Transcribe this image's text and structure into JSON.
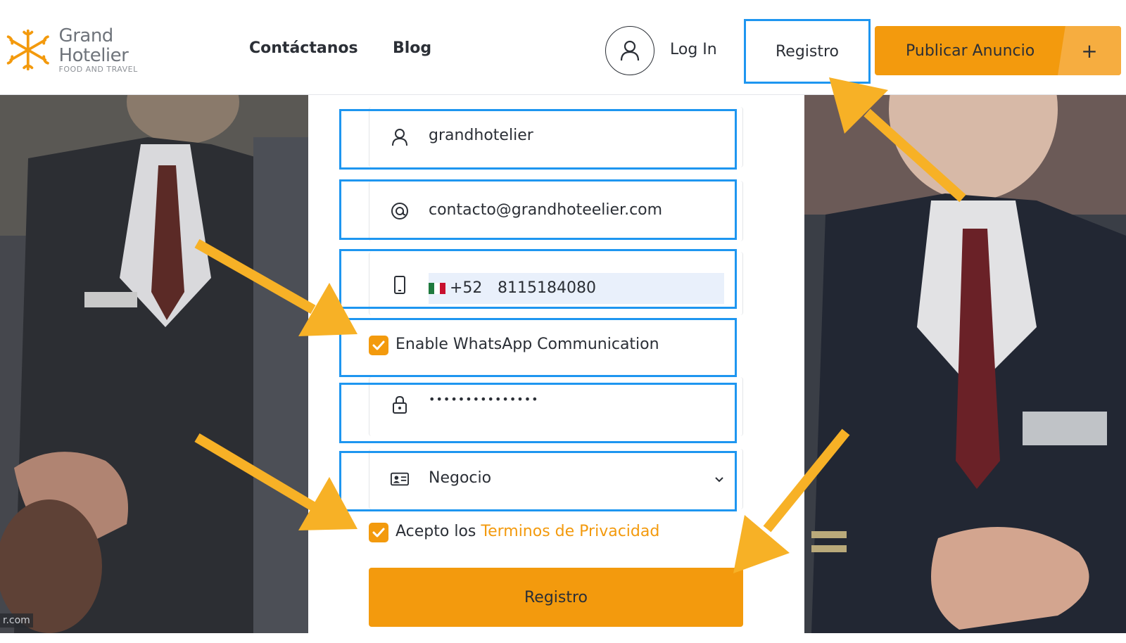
{
  "header": {
    "logo_name": "Grand Hotelier",
    "logo_tagline": "FOOD AND TRAVEL",
    "nav": [
      "Contáctanos",
      "Blog"
    ],
    "login_label": "Log In",
    "register_label": "Registro",
    "publish_label": "Publicar Anuncio",
    "publish_plus": "+"
  },
  "form": {
    "username": "grandhotelier",
    "email": "contacto@grandhoteelier.com",
    "phone": {
      "dial_code": "+52",
      "number": "8115184080"
    },
    "whatsapp_label": "Enable WhatsApp Communication",
    "whatsapp_checked": true,
    "password_mask": "•••••••••••••••",
    "account_type": "Negocio",
    "terms_prefix": "Acepto los ",
    "terms_link": "Terminos de Privacidad",
    "terms_checked": true,
    "submit_label": "Registro"
  },
  "watermark": "r.com",
  "colors": {
    "accent": "#f39a0d",
    "highlight": "#1e96f0",
    "arrow": "#f7b126",
    "text": "#2b2f36"
  },
  "icons": [
    "logo-icon",
    "user-circle-icon",
    "user-icon",
    "at-icon",
    "phone-icon",
    "mexico-flag-icon",
    "checkmark-icon",
    "lock-icon",
    "id-card-icon",
    "chevron-down-icon",
    "plus-icon"
  ]
}
